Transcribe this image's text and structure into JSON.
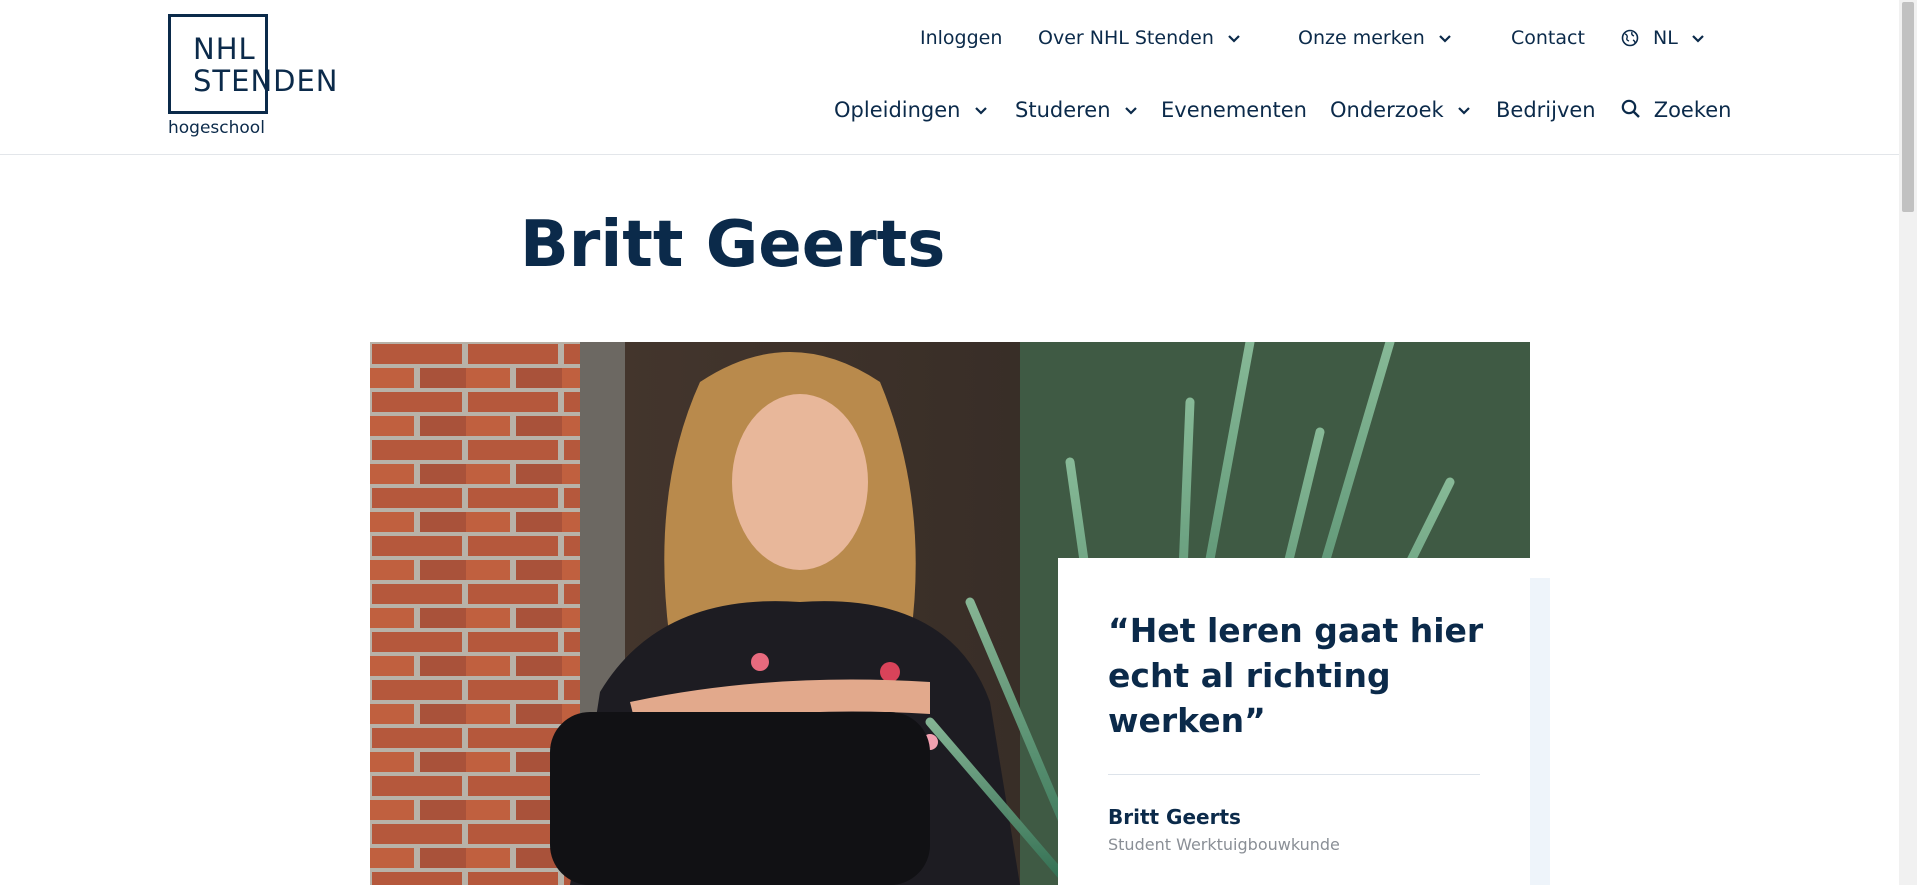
{
  "logo": {
    "line1": "NHL",
    "line2": "STENDEN",
    "line3": "hogeschool"
  },
  "topnav": {
    "login": "Inloggen",
    "about": "Over NHL Stenden",
    "brands": "Onze merken",
    "contact": "Contact",
    "language": "NL"
  },
  "mainnav": {
    "programs": "Opleidingen",
    "study": "Studeren",
    "events": "Evenementen",
    "research": "Onderzoek",
    "companies": "Bedrijven",
    "search": "Zoeken"
  },
  "page": {
    "title": "Britt Geerts"
  },
  "quote_card": {
    "quote": "“Het leren gaat hier echt al richting werken”",
    "name": "Britt Geerts",
    "role": "Student Werktuigbouwkunde"
  },
  "colors": {
    "brand": "#0b2a4a",
    "accent_panel": "#eef4fa"
  },
  "icons": [
    "chevron-down-icon",
    "globe-icon",
    "search-icon"
  ]
}
